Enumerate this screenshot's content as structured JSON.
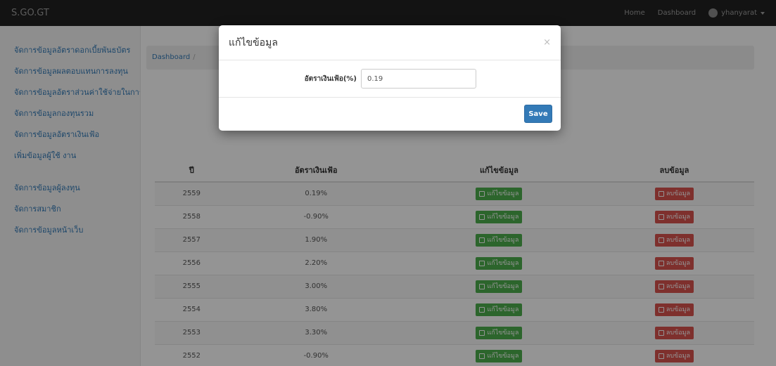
{
  "navbar": {
    "brand": "S.GO.GT",
    "home": "Home",
    "dashboard": "Dashboard",
    "user": "yhanyarat"
  },
  "sidebar": {
    "items": [
      "จัดการข้อมูลอัตราดอกเบี้ยพันธบัตร",
      "จัดการข้อมูลผลตอบแทนการลงทุน",
      "จัดการข้อมูลอัตราส่วนค่าใช้จ่ายในการลงทุน",
      "จัดการข้อมูลกองทุนรวม",
      "จัดการข้อมูลอัตราเงินเฟ้อ",
      "เพิ่มข้อมูลผู้ใช้ งาน",
      "จัดการข้อมูลผู้ลงทุน",
      "จัดการสมาชิก",
      "จัดการข้อมูลหน้าเว็บ"
    ]
  },
  "breadcrumb": "Dashboard",
  "table": {
    "headers": [
      "ปี",
      "อัตราเงินเฟ้อ",
      "แก้ไขข้อมูล",
      "ลบข้อมูล"
    ],
    "edit_label": "แก้ไขข้อมูล",
    "delete_label": "ลบข้อมูล",
    "rows": [
      [
        "2559",
        "0.19%"
      ],
      [
        "2558",
        "-0.90%"
      ],
      [
        "2557",
        "1.90%"
      ],
      [
        "2556",
        "2.20%"
      ],
      [
        "2555",
        "3.00%"
      ],
      [
        "2554",
        "3.80%"
      ],
      [
        "2553",
        "3.30%"
      ],
      [
        "2552",
        "-0.90%"
      ]
    ]
  },
  "modal": {
    "title": "แก้ไขข้อมูล",
    "close": "×",
    "field_label": "อัตราเงินเฟ้อ(%)",
    "field_value": "0.19",
    "save_label": "Save"
  },
  "colors": {
    "navbar": "#222222",
    "link": "#337ab7",
    "edit_button": "#4cae4c",
    "delete_button": "#d9534f",
    "save_button": "#337ab7"
  }
}
